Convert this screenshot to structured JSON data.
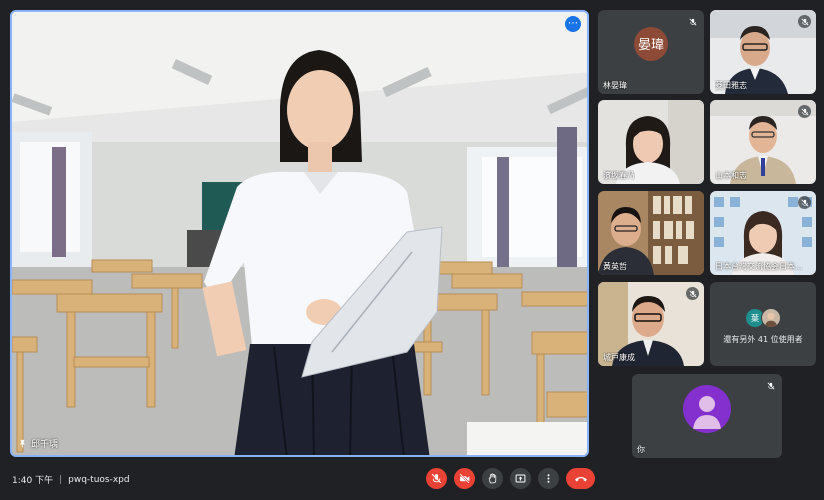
{
  "main": {
    "speaker_name": "邱千瑀",
    "more_label": "⋯"
  },
  "participants": [
    {
      "name": "林晏瑋",
      "initials": "晏瑋",
      "avatar_color": "#8d4a37"
    },
    {
      "name": "菱田雅志"
    },
    {
      "name": "濱坂春乃"
    },
    {
      "name": "山本和志"
    },
    {
      "name": "黃英哲"
    },
    {
      "name": "日本台灣交流協会日本..."
    },
    {
      "name": "城戸康成"
    }
  ],
  "others": {
    "label": "還有另外 41 位使用者",
    "avatars": [
      {
        "initials": "葉",
        "color": "#1e8e8e"
      },
      {
        "initials": "",
        "color": "#c9b7a6"
      }
    ]
  },
  "self": {
    "name": "你",
    "avatar_color": "#8430ce"
  },
  "bottombar": {
    "time": "1:40 下午",
    "separator": "|",
    "meeting_code": "pwq-tuos-xpd"
  },
  "colors": {
    "background": "#202124",
    "tile": "#3c4043",
    "active_border": "#8ab4f8",
    "danger": "#ea4335"
  }
}
